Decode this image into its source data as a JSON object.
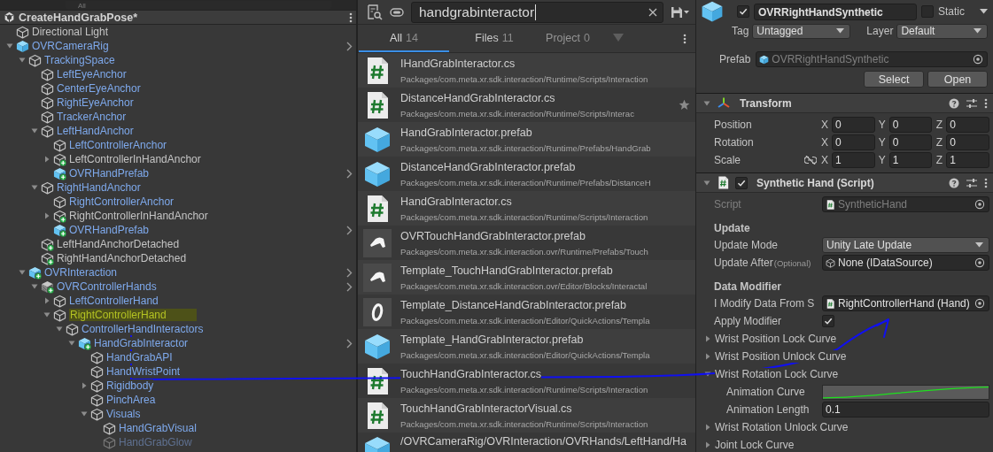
{
  "hierarchy": {
    "search": {
      "placeholder": "All"
    },
    "scene": "CreateHandGrabPose*",
    "items": [
      {
        "name": "Directional Light",
        "kind": "object",
        "prefab_link": false,
        "open_arrow": false,
        "highlighted": false,
        "disabled": false
      },
      {
        "name": "OVRCameraRig",
        "kind": "prefab",
        "expanded": true,
        "prefab_link": true,
        "open_arrow": true,
        "highlighted": false,
        "disabled": false,
        "children": [
          {
            "name": "TrackingSpace",
            "kind": "object",
            "expanded": true,
            "prefab_link": true,
            "open_arrow": false,
            "highlighted": false,
            "disabled": false,
            "children": [
              {
                "name": "LeftEyeAnchor",
                "kind": "object",
                "prefab_link": true,
                "open_arrow": false,
                "highlighted": false,
                "disabled": false
              },
              {
                "name": "CenterEyeAnchor",
                "kind": "object",
                "prefab_link": true,
                "open_arrow": false,
                "highlighted": false,
                "disabled": false
              },
              {
                "name": "RightEyeAnchor",
                "kind": "object",
                "prefab_link": true,
                "open_arrow": false,
                "highlighted": false,
                "disabled": false
              },
              {
                "name": "TrackerAnchor",
                "kind": "object",
                "prefab_link": true,
                "open_arrow": false,
                "highlighted": false,
                "disabled": false
              },
              {
                "name": "LeftHandAnchor",
                "kind": "object",
                "expanded": true,
                "prefab_link": true,
                "open_arrow": false,
                "highlighted": false,
                "disabled": false,
                "children": [
                  {
                    "name": "LeftControllerAnchor",
                    "kind": "object",
                    "prefab_link": true,
                    "open_arrow": false,
                    "highlighted": false,
                    "disabled": false
                  },
                  {
                    "name": "LeftControllerInHandAnchor",
                    "kind": "object-added",
                    "expanded": false,
                    "prefab_link": false,
                    "open_arrow": false,
                    "highlighted": false,
                    "disabled": false
                  },
                  {
                    "name": "OVRHandPrefab",
                    "kind": "prefab-added",
                    "prefab_link": true,
                    "open_arrow": true,
                    "highlighted": false,
                    "disabled": false
                  }
                ]
              },
              {
                "name": "RightHandAnchor",
                "kind": "object",
                "expanded": true,
                "prefab_link": true,
                "open_arrow": false,
                "highlighted": false,
                "disabled": false,
                "children": [
                  {
                    "name": "RightControllerAnchor",
                    "kind": "object",
                    "prefab_link": true,
                    "open_arrow": false,
                    "highlighted": false,
                    "disabled": false
                  },
                  {
                    "name": "RightControllerInHandAnchor",
                    "kind": "object-added",
                    "expanded": false,
                    "prefab_link": false,
                    "open_arrow": false,
                    "highlighted": false,
                    "disabled": false
                  },
                  {
                    "name": "OVRHandPrefab",
                    "kind": "prefab-added",
                    "prefab_link": true,
                    "open_arrow": true,
                    "highlighted": false,
                    "disabled": false
                  }
                ]
              },
              {
                "name": "LeftHandAnchorDetached",
                "kind": "object-added",
                "prefab_link": false,
                "open_arrow": false,
                "highlighted": false,
                "disabled": false
              },
              {
                "name": "RightHandAnchorDetached",
                "kind": "object-added",
                "prefab_link": false,
                "open_arrow": false,
                "highlighted": false,
                "disabled": false
              }
            ]
          },
          {
            "name": "OVRInteraction",
            "kind": "prefab-added",
            "expanded": true,
            "prefab_link": true,
            "open_arrow": true,
            "highlighted": false,
            "disabled": false,
            "children": [
              {
                "name": "OVRControllerHands",
                "kind": "model-added",
                "expanded": true,
                "prefab_link": true,
                "open_arrow": true,
                "highlighted": false,
                "disabled": false,
                "children": [
                  {
                    "name": "LeftControllerHand",
                    "kind": "object",
                    "expanded": false,
                    "prefab_link": true,
                    "open_arrow": false,
                    "highlighted": false,
                    "disabled": false
                  },
                  {
                    "name": "RightControllerHand",
                    "kind": "object",
                    "expanded": true,
                    "prefab_link": true,
                    "open_arrow": false,
                    "highlighted": true,
                    "disabled": false,
                    "children": [
                      {
                        "name": "ControllerHandInteractors",
                        "kind": "object",
                        "expanded": true,
                        "prefab_link": true,
                        "open_arrow": false,
                        "highlighted": false,
                        "disabled": false,
                        "children": [
                          {
                            "name": "HandGrabInteractor",
                            "kind": "prefab-added",
                            "expanded": true,
                            "prefab_link": true,
                            "open_arrow": true,
                            "highlighted": false,
                            "disabled": false,
                            "children": [
                              {
                                "name": "HandGrabAPI",
                                "kind": "object",
                                "prefab_link": true,
                                "open_arrow": false,
                                "highlighted": false,
                                "disabled": false
                              },
                              {
                                "name": "HandWristPoint",
                                "kind": "object",
                                "prefab_link": true,
                                "open_arrow": false,
                                "highlighted": false,
                                "disabled": false
                              },
                              {
                                "name": "Rigidbody",
                                "kind": "object",
                                "expanded": false,
                                "prefab_link": true,
                                "open_arrow": false,
                                "highlighted": false,
                                "disabled": false
                              },
                              {
                                "name": "PinchArea",
                                "kind": "object",
                                "prefab_link": true,
                                "open_arrow": false,
                                "highlighted": false,
                                "disabled": false
                              },
                              {
                                "name": "Visuals",
                                "kind": "object",
                                "expanded": true,
                                "prefab_link": true,
                                "open_arrow": false,
                                "highlighted": false,
                                "disabled": false,
                                "children": [
                                  {
                                    "name": "HandGrabVisual",
                                    "kind": "object",
                                    "prefab_link": true,
                                    "open_arrow": false,
                                    "highlighted": false,
                                    "disabled": false
                                  },
                                  {
                                    "name": "HandGrabGlow",
                                    "kind": "object",
                                    "prefab_link": true,
                                    "open_arrow": false,
                                    "highlighted": false,
                                    "disabled": true
                                  }
                                ]
                              }
                            ]
                          }
                        ]
                      }
                    ]
                  }
                ]
              }
            ]
          }
        ]
      }
    ]
  },
  "search": {
    "query": "handgrabinteractor",
    "tabs": [
      {
        "label": "All",
        "count": "14",
        "selected": true,
        "disabled": false,
        "dropdown": false
      },
      {
        "label": "Files",
        "count": "11",
        "selected": false,
        "disabled": false,
        "dropdown": false
      },
      {
        "label": "Project",
        "count": "0",
        "selected": false,
        "disabled": true,
        "dropdown": true
      }
    ],
    "results": [
      {
        "kind": "script",
        "name": "IHandGrabInteractor.cs",
        "path": "Packages/com.meta.xr.sdk.interaction/Runtime/Scripts/Interaction",
        "favorite": false
      },
      {
        "kind": "script",
        "name": "DistanceHandGrabInteractor.cs",
        "path": "Packages/com.meta.xr.sdk.interaction/Runtime/Scripts/Interac",
        "favorite": true
      },
      {
        "kind": "prefab",
        "name": "HandGrabInteractor.prefab",
        "path": "Packages/com.meta.xr.sdk.interaction/Runtime/Prefabs/HandGrab",
        "favorite": false
      },
      {
        "kind": "prefab",
        "name": "DistanceHandGrabInteractor.prefab",
        "path": "Packages/com.meta.xr.sdk.interaction/Runtime/Prefabs/DistanceH",
        "favorite": false
      },
      {
        "kind": "script",
        "name": "HandGrabInteractor.cs",
        "path": "Packages/com.meta.xr.sdk.interaction/Runtime/Scripts/Interaction",
        "favorite": false
      },
      {
        "kind": "controller",
        "name": "OVRTouchHandGrabInteractor.prefab",
        "path": "Packages/com.meta.xr.sdk.interaction.ovr/Runtime/Prefabs/Touch",
        "favorite": false
      },
      {
        "kind": "controller",
        "name": "Template_TouchHandGrabInteractor.prefab",
        "path": "Packages/com.meta.xr.sdk.interaction.ovr/Editor/Blocks/Interactal",
        "favorite": false
      },
      {
        "kind": "ring",
        "name": "Template_DistanceHandGrabInteractor.prefab",
        "path": "Packages/com.meta.xr.sdk.interaction/Editor/QuickActions/Templa",
        "favorite": false
      },
      {
        "kind": "prefab",
        "name": "Template_HandGrabInteractor.prefab",
        "path": "Packages/com.meta.xr.sdk.interaction/Editor/QuickActions/Templa",
        "favorite": false
      },
      {
        "kind": "script",
        "name": "TouchHandGrabInteractor.cs",
        "path": "Packages/com.meta.xr.sdk.interaction/Runtime/Scripts/Interaction",
        "favorite": false
      },
      {
        "kind": "script",
        "name": "TouchHandGrabInteractorVisual.cs",
        "path": "Packages/com.meta.xr.sdk.interaction/Runtime/Scripts/Interaction",
        "favorite": false
      },
      {
        "kind": "prefab",
        "name": "/OVRCameraRig/OVRInteraction/OVRHands/LeftHand/Ha",
        "favorite": false
      }
    ]
  },
  "inspector": {
    "object": {
      "active": true,
      "name": "OVRRightHandSynthetic",
      "static": false,
      "static_label": "Static",
      "tag_label": "Tag",
      "tag": "Untagged",
      "layer_label": "Layer",
      "layer": "Default",
      "prefab_label": "Prefab",
      "prefab": "OVRRightHandSynthetic",
      "buttons": [
        "Select",
        "Open"
      ]
    },
    "transform": {
      "title": "Transform",
      "expanded": true,
      "rows": [
        {
          "label": "Position",
          "proportional": false,
          "values": [
            {
              "axis": "X",
              "value": "0"
            },
            {
              "axis": "Y",
              "value": "0"
            },
            {
              "axis": "Z",
              "value": "0"
            }
          ]
        },
        {
          "label": "Rotation",
          "proportional": false,
          "values": [
            {
              "axis": "X",
              "value": "0"
            },
            {
              "axis": "Y",
              "value": "0"
            },
            {
              "axis": "Z",
              "value": "0"
            }
          ]
        },
        {
          "label": "Scale",
          "proportional": true,
          "values": [
            {
              "axis": "X",
              "value": "1"
            },
            {
              "axis": "Y",
              "value": "1"
            },
            {
              "axis": "Z",
              "value": "1"
            }
          ]
        }
      ]
    },
    "component": {
      "title": "Synthetic Hand (Script)",
      "expanded": true,
      "enabled": true,
      "script_label": "Script",
      "script": "SyntheticHand",
      "rows": [
        {
          "kind": "header",
          "label": "Update"
        },
        {
          "kind": "dropdown",
          "label": "Update Mode",
          "value": "Unity Late Update"
        },
        {
          "kind": "object",
          "label": "Update After",
          "hint": "(Optional)",
          "value": "None (IDataSource)"
        },
        {
          "kind": "header",
          "label": "Data Modifier"
        },
        {
          "kind": "script-ref",
          "label": "I Modify Data From S",
          "value": "RightControllerHand (Hand)"
        },
        {
          "kind": "checkbox",
          "label": "Apply Modifier",
          "checked": true
        },
        {
          "kind": "foldout",
          "label": "Wrist Position Lock Curve",
          "expanded": false
        },
        {
          "kind": "foldout",
          "label": "Wrist Position Unlock Curve",
          "expanded": false
        },
        {
          "kind": "foldout",
          "label": "Wrist Rotation Lock Curve",
          "expanded": true,
          "children": [
            {
              "kind": "curve",
              "label": "Animation Curve"
            },
            {
              "kind": "number",
              "label": "Animation Length",
              "value": "0.1"
            }
          ]
        },
        {
          "kind": "foldout",
          "label": "Wrist Rotation Unlock Curve",
          "expanded": false
        },
        {
          "kind": "foldout",
          "label": "Joint Lock Curve",
          "expanded": false
        }
      ]
    }
  }
}
